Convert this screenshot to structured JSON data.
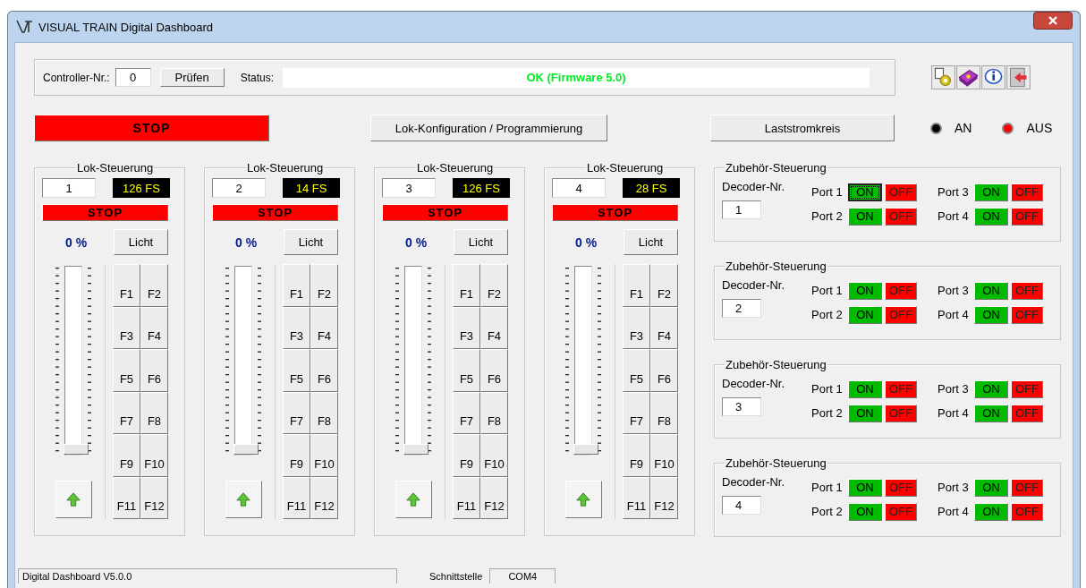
{
  "window": {
    "title": "VISUAL TRAIN Digital Dashboard"
  },
  "controller": {
    "label": "Controller-Nr.:",
    "value": "0",
    "check_button": "Prüfen",
    "status_label": "Status:",
    "status": "OK (Firmware 5.0)"
  },
  "stop_button": "STOP",
  "config_button": "Lok-Konfiguration / Programmierung",
  "power_button": "Laststromkreis",
  "indicators": [
    {
      "label": "AN",
      "color": "#000000"
    },
    {
      "label": "AUS",
      "color": "#ff0000"
    }
  ],
  "locos": [
    {
      "title": "Lok-Steuerung",
      "address": "1",
      "speed_steps": "126 FS",
      "stop": "STOP",
      "speed": "0 %",
      "light": "Licht",
      "level": 0,
      "functions": [
        "F1",
        "F2",
        "F3",
        "F4",
        "F5",
        "F6",
        "F7",
        "F8",
        "F9",
        "F10",
        "F11",
        "F12"
      ]
    },
    {
      "title": "Lok-Steuerung",
      "address": "2",
      "speed_steps": "14 FS",
      "stop": "STOP",
      "speed": "0 %",
      "light": "Licht",
      "level": 0,
      "functions": [
        "F1",
        "F2",
        "F3",
        "F4",
        "F5",
        "F6",
        "F7",
        "F8",
        "F9",
        "F10",
        "F11",
        "F12"
      ]
    },
    {
      "title": "Lok-Steuerung",
      "address": "3",
      "speed_steps": "126 FS",
      "stop": "STOP",
      "speed": "0 %",
      "light": "Licht",
      "level": 0,
      "functions": [
        "F1",
        "F2",
        "F3",
        "F4",
        "F5",
        "F6",
        "F7",
        "F8",
        "F9",
        "F10",
        "F11",
        "F12"
      ]
    },
    {
      "title": "Lok-Steuerung",
      "address": "4",
      "speed_steps": "28 FS",
      "stop": "STOP",
      "speed": "0 %",
      "light": "Licht",
      "level": 0,
      "functions": [
        "F1",
        "F2",
        "F3",
        "F4",
        "F5",
        "F6",
        "F7",
        "F8",
        "F9",
        "F10",
        "F11",
        "F12"
      ]
    }
  ],
  "accessories": [
    {
      "title": "Zubehör-Steuerung",
      "decoder_label": "Decoder-Nr.",
      "decoder": "1",
      "ports": [
        {
          "label": "Port 1",
          "on": "ON",
          "off": "OFF",
          "focused": true
        },
        {
          "label": "Port 2",
          "on": "ON",
          "off": "OFF",
          "focused": false
        },
        {
          "label": "Port 3",
          "on": "ON",
          "off": "OFF",
          "focused": false
        },
        {
          "label": "Port 4",
          "on": "ON",
          "off": "OFF",
          "focused": false
        }
      ]
    },
    {
      "title": "Zubehör-Steuerung",
      "decoder_label": "Decoder-Nr.",
      "decoder": "2",
      "ports": [
        {
          "label": "Port 1",
          "on": "ON",
          "off": "OFF",
          "focused": false
        },
        {
          "label": "Port 2",
          "on": "ON",
          "off": "OFF",
          "focused": false
        },
        {
          "label": "Port 3",
          "on": "ON",
          "off": "OFF",
          "focused": false
        },
        {
          "label": "Port 4",
          "on": "ON",
          "off": "OFF",
          "focused": false
        }
      ]
    },
    {
      "title": "Zubehör-Steuerung",
      "decoder_label": "Decoder-Nr.",
      "decoder": "3",
      "ports": [
        {
          "label": "Port 1",
          "on": "ON",
          "off": "OFF",
          "focused": false
        },
        {
          "label": "Port 2",
          "on": "ON",
          "off": "OFF",
          "focused": false
        },
        {
          "label": "Port 3",
          "on": "ON",
          "off": "OFF",
          "focused": false
        },
        {
          "label": "Port 4",
          "on": "ON",
          "off": "OFF",
          "focused": false
        }
      ]
    },
    {
      "title": "Zubehör-Steuerung",
      "decoder_label": "Decoder-Nr.",
      "decoder": "4",
      "ports": [
        {
          "label": "Port 1",
          "on": "ON",
          "off": "OFF",
          "focused": false
        },
        {
          "label": "Port 2",
          "on": "ON",
          "off": "OFF",
          "focused": false
        },
        {
          "label": "Port 3",
          "on": "ON",
          "off": "OFF",
          "focused": false
        },
        {
          "label": "Port 4",
          "on": "ON",
          "off": "OFF",
          "focused": false
        }
      ]
    }
  ],
  "status_bar": {
    "version": "Digital Dashboard V5.0.0",
    "interface_label": "Schnittstelle",
    "interface": "COM4"
  }
}
